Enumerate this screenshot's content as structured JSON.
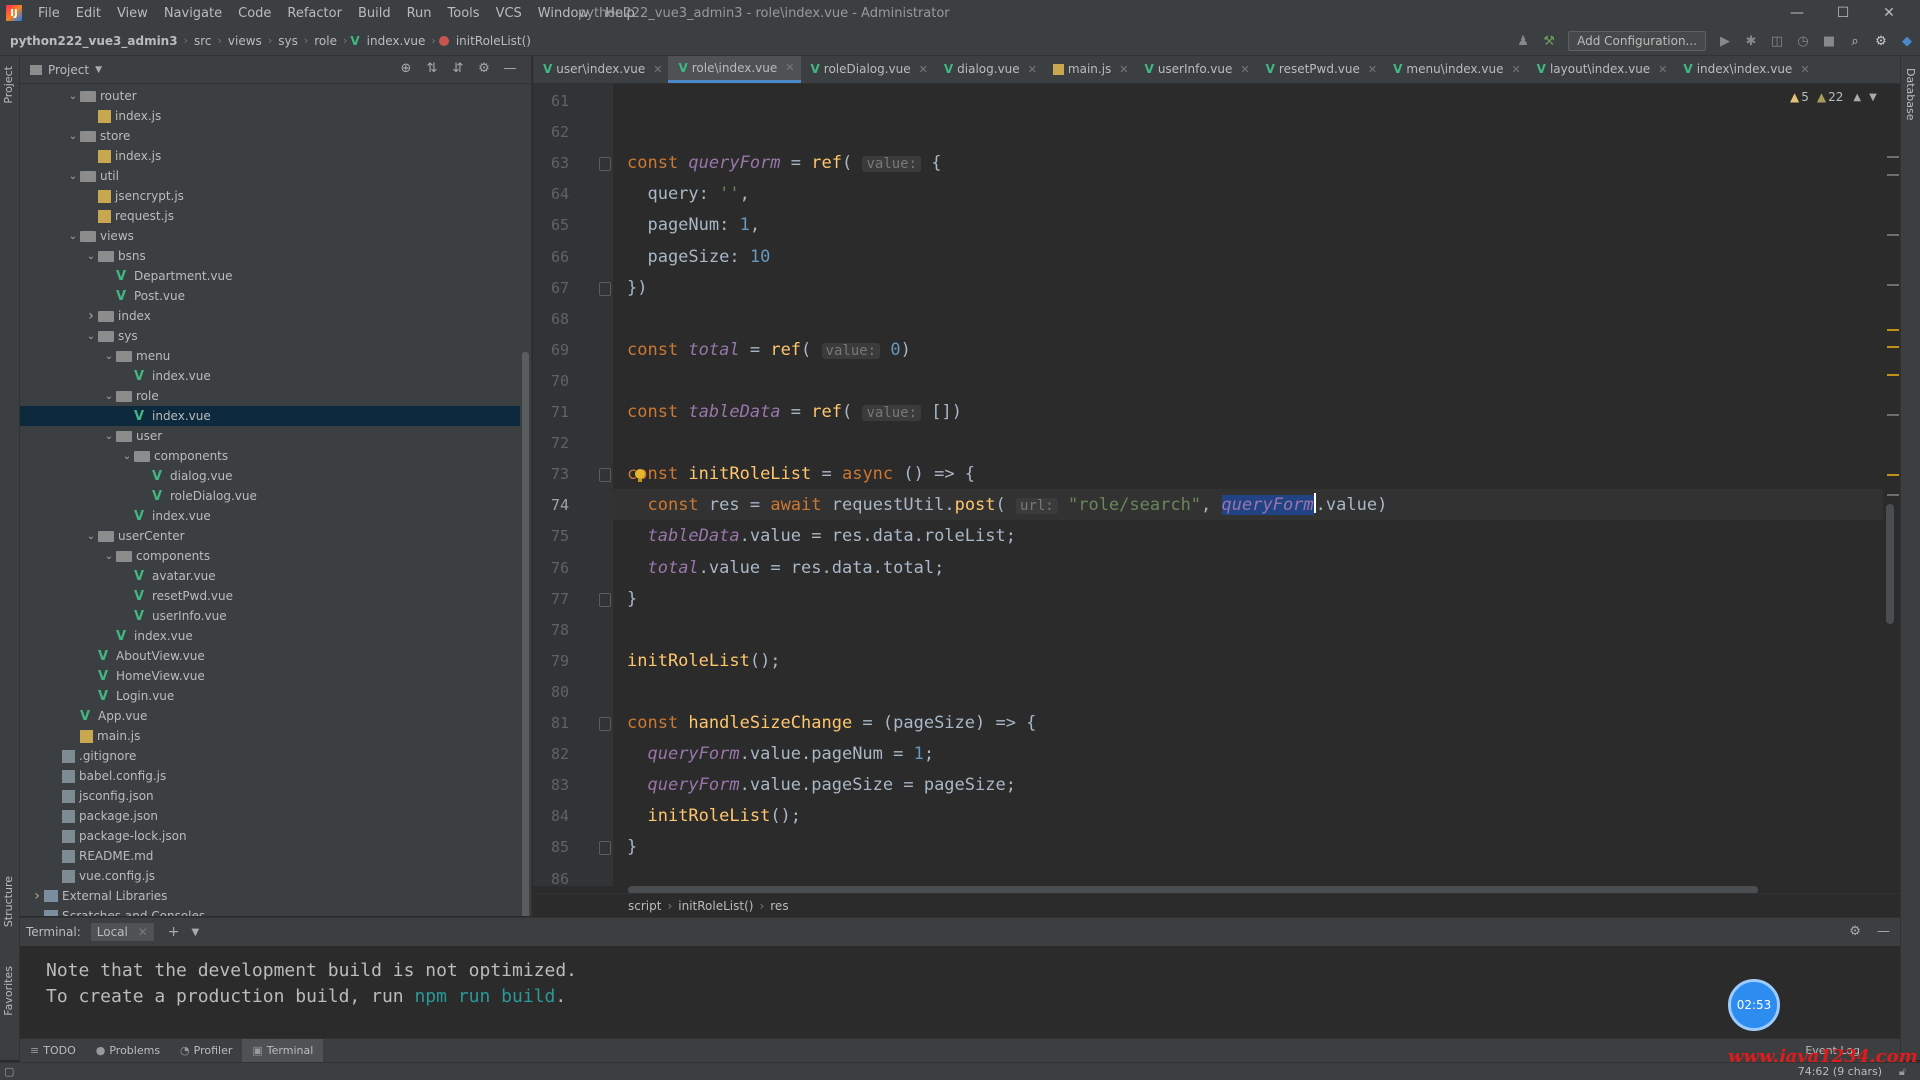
{
  "menubar": {
    "logo": "IJ",
    "items": [
      "File",
      "Edit",
      "View",
      "Navigate",
      "Code",
      "Refactor",
      "Build",
      "Run",
      "Tools",
      "VCS",
      "Window",
      "Help"
    ],
    "window_title": "python222_vue3_admin3 - role\\index.vue - Administrator",
    "minimize": "—",
    "maximize": "☐",
    "close": "✕"
  },
  "navbar": {
    "project": "python222_vue3_admin3",
    "crumbs": [
      "src",
      "views",
      "sys",
      "role",
      "index.vue",
      "initRoleList()"
    ],
    "add_configuration": "Add Configuration..."
  },
  "left_strip": {
    "project_tab": "Project",
    "structure_tab": "Structure",
    "favorites_tab": "Favorites"
  },
  "right_strip": {
    "database_tab": "Database"
  },
  "project_panel": {
    "title": "Project",
    "tree": [
      {
        "label": "router",
        "type": "folder",
        "depth": 2,
        "expanded": true
      },
      {
        "label": "index.js",
        "type": "js",
        "depth": 3
      },
      {
        "label": "store",
        "type": "folder",
        "depth": 2,
        "expanded": true
      },
      {
        "label": "index.js",
        "type": "js",
        "depth": 3
      },
      {
        "label": "util",
        "type": "folder",
        "depth": 2,
        "expanded": true
      },
      {
        "label": "jsencrypt.js",
        "type": "js",
        "depth": 3
      },
      {
        "label": "request.js",
        "type": "js",
        "depth": 3
      },
      {
        "label": "views",
        "type": "folder",
        "depth": 2,
        "expanded": true
      },
      {
        "label": "bsns",
        "type": "folder",
        "depth": 3,
        "expanded": true
      },
      {
        "label": "Department.vue",
        "type": "vue",
        "depth": 4
      },
      {
        "label": "Post.vue",
        "type": "vue",
        "depth": 4
      },
      {
        "label": "index",
        "type": "folder",
        "depth": 3,
        "expanded": false
      },
      {
        "label": "sys",
        "type": "folder",
        "depth": 3,
        "expanded": true
      },
      {
        "label": "menu",
        "type": "folder",
        "depth": 4,
        "expanded": true
      },
      {
        "label": "index.vue",
        "type": "vue",
        "depth": 5
      },
      {
        "label": "role",
        "type": "folder",
        "depth": 4,
        "expanded": true
      },
      {
        "label": "index.vue",
        "type": "vue",
        "depth": 5,
        "selected": true
      },
      {
        "label": "user",
        "type": "folder",
        "depth": 4,
        "expanded": true
      },
      {
        "label": "components",
        "type": "folder",
        "depth": 5,
        "expanded": true
      },
      {
        "label": "dialog.vue",
        "type": "vue",
        "depth": 6
      },
      {
        "label": "roleDialog.vue",
        "type": "vue",
        "depth": 6
      },
      {
        "label": "index.vue",
        "type": "vue",
        "depth": 5
      },
      {
        "label": "userCenter",
        "type": "folder",
        "depth": 3,
        "expanded": true
      },
      {
        "label": "components",
        "type": "folder",
        "depth": 4,
        "expanded": true
      },
      {
        "label": "avatar.vue",
        "type": "vue",
        "depth": 5
      },
      {
        "label": "resetPwd.vue",
        "type": "vue",
        "depth": 5
      },
      {
        "label": "userInfo.vue",
        "type": "vue",
        "depth": 5
      },
      {
        "label": "index.vue",
        "type": "vue",
        "depth": 4
      },
      {
        "label": "AboutView.vue",
        "type": "vue",
        "depth": 3
      },
      {
        "label": "HomeView.vue",
        "type": "vue",
        "depth": 3
      },
      {
        "label": "Login.vue",
        "type": "vue",
        "depth": 3
      },
      {
        "label": "App.vue",
        "type": "vue",
        "depth": 2
      },
      {
        "label": "main.js",
        "type": "js",
        "depth": 2
      },
      {
        "label": ".gitignore",
        "type": "cfg",
        "depth": 1
      },
      {
        "label": "babel.config.js",
        "type": "cfg",
        "depth": 1
      },
      {
        "label": "jsconfig.json",
        "type": "cfg",
        "depth": 1
      },
      {
        "label": "package.json",
        "type": "cfg",
        "depth": 1
      },
      {
        "label": "package-lock.json",
        "type": "cfg",
        "depth": 1
      },
      {
        "label": "README.md",
        "type": "cfg",
        "depth": 1
      },
      {
        "label": "vue.config.js",
        "type": "cfg",
        "depth": 1
      },
      {
        "label": "External Libraries",
        "type": "lib",
        "depth": 0,
        "expanded": false
      },
      {
        "label": "Scratches and Consoles",
        "type": "lib",
        "depth": 0
      }
    ]
  },
  "tabs": [
    {
      "label": "user\\index.vue",
      "kind": "vue"
    },
    {
      "label": "role\\index.vue",
      "kind": "vue",
      "active": true
    },
    {
      "label": "roleDialog.vue",
      "kind": "vue"
    },
    {
      "label": "dialog.vue",
      "kind": "vue"
    },
    {
      "label": "main.js",
      "kind": "js"
    },
    {
      "label": "userInfo.vue",
      "kind": "vue"
    },
    {
      "label": "resetPwd.vue",
      "kind": "vue"
    },
    {
      "label": "menu\\index.vue",
      "kind": "vue"
    },
    {
      "label": "layout\\index.vue",
      "kind": "vue"
    },
    {
      "label": "index\\index.vue",
      "kind": "vue"
    }
  ],
  "inspections": {
    "warnings": "5",
    "weak_warnings": "22"
  },
  "editor": {
    "first_line": 61,
    "current_line": 74,
    "lines": [
      [],
      [],
      [
        [
          "kw",
          "const "
        ],
        [
          "var",
          "queryForm"
        ],
        [
          "p",
          " = "
        ],
        [
          "fn",
          "ref"
        ],
        [
          "p",
          "( "
        ],
        [
          "hint",
          "value:"
        ],
        [
          "p",
          " {"
        ]
      ],
      [
        [
          "p",
          "  query: "
        ],
        [
          "str",
          "''"
        ],
        [
          "p",
          ","
        ]
      ],
      [
        [
          "p",
          "  pageNum: "
        ],
        [
          "num",
          "1"
        ],
        [
          "p",
          ","
        ]
      ],
      [
        [
          "p",
          "  pageSize: "
        ],
        [
          "num",
          "10"
        ]
      ],
      [
        [
          "p",
          "})"
        ]
      ],
      [],
      [
        [
          "kw",
          "const "
        ],
        [
          "var",
          "total"
        ],
        [
          "p",
          " = "
        ],
        [
          "fn",
          "ref"
        ],
        [
          "p",
          "( "
        ],
        [
          "hint",
          "value:"
        ],
        [
          "p",
          " "
        ],
        [
          "num",
          "0"
        ],
        [
          "p",
          ")"
        ]
      ],
      [],
      [
        [
          "kw",
          "const "
        ],
        [
          "var",
          "tableData"
        ],
        [
          "p",
          " = "
        ],
        [
          "fn",
          "ref"
        ],
        [
          "p",
          "( "
        ],
        [
          "hint",
          "value:"
        ],
        [
          "p",
          " [])"
        ]
      ],
      [],
      [
        [
          "kw",
          "const "
        ],
        [
          "fn",
          "initRoleList"
        ],
        [
          "p",
          " = "
        ],
        [
          "kw",
          "async "
        ],
        [
          "p",
          "() => {"
        ]
      ],
      [
        [
          "p",
          "  "
        ],
        [
          "kw",
          "const "
        ],
        [
          "p",
          "res = "
        ],
        [
          "kw",
          "await "
        ],
        [
          "p",
          "requestUtil."
        ],
        [
          "fn",
          "post"
        ],
        [
          "p",
          "( "
        ],
        [
          "hint",
          "url:"
        ],
        [
          "p",
          " "
        ],
        [
          "str",
          "\"role/search\""
        ],
        [
          "p",
          ", "
        ],
        [
          "hlvar",
          "queryForm"
        ],
        [
          "caret",
          ""
        ],
        [
          "p",
          ".value)"
        ]
      ],
      [
        [
          "p",
          "  "
        ],
        [
          "var",
          "tableData"
        ],
        [
          "p",
          ".value = res.data.roleList;"
        ]
      ],
      [
        [
          "p",
          "  "
        ],
        [
          "var",
          "total"
        ],
        [
          "p",
          ".value = res.data.total;"
        ]
      ],
      [
        [
          "p",
          "}"
        ]
      ],
      [],
      [
        [
          "fn",
          "initRoleList"
        ],
        [
          "p",
          "();"
        ]
      ],
      [],
      [
        [
          "kw",
          "const "
        ],
        [
          "fn",
          "handleSizeChange"
        ],
        [
          "p",
          " = (pageSize) => {"
        ]
      ],
      [
        [
          "p",
          "  "
        ],
        [
          "var",
          "queryForm"
        ],
        [
          "p",
          ".value.pageNum = "
        ],
        [
          "num",
          "1"
        ],
        [
          "p",
          ";"
        ]
      ],
      [
        [
          "p",
          "  "
        ],
        [
          "var",
          "queryForm"
        ],
        [
          "p",
          ".value.pageSize = pageSize;"
        ]
      ],
      [
        [
          "p",
          "  "
        ],
        [
          "fn",
          "initRoleList"
        ],
        [
          "p",
          "();"
        ]
      ],
      [
        [
          "p",
          "}"
        ]
      ],
      []
    ]
  },
  "breadcrumb": [
    "script",
    "initRoleList()",
    "res"
  ],
  "terminal": {
    "label": "Terminal:",
    "tab": "Local",
    "lines": [
      [
        [
          "p",
          "Note that the development build is not optimized."
        ]
      ],
      [
        [
          "p",
          "To create a production build, run "
        ],
        [
          "cmd",
          "npm run build"
        ],
        [
          "p",
          "."
        ]
      ]
    ],
    "timer": "02:53"
  },
  "tool_tabs": [
    {
      "label": "TODO",
      "icon": "≡"
    },
    {
      "label": "Problems",
      "icon": "●"
    },
    {
      "label": "Profiler",
      "icon": "◔"
    },
    {
      "label": "Terminal",
      "icon": "▣",
      "active": true
    }
  ],
  "event_log": "Event Log",
  "status": {
    "position": "74:62 (9 chars)"
  },
  "watermark": "www.java1234.com",
  "colors": {
    "keyword": "#cc7832",
    "variable": "#9876aa",
    "function": "#ffc66d",
    "string": "#6a8759",
    "number": "#6897bb",
    "vue": "#41b883",
    "selection": "#214283"
  }
}
